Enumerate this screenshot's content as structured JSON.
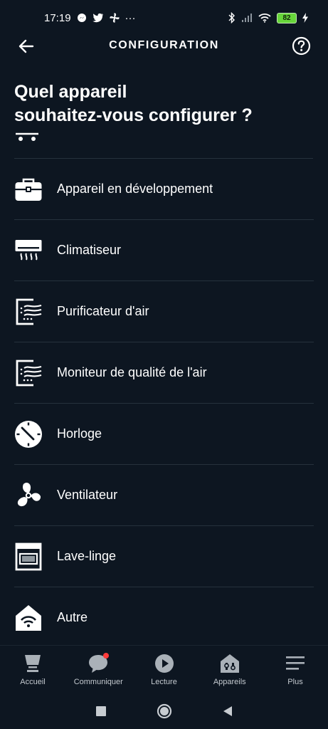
{
  "status_bar": {
    "time": "17:19",
    "more": "···",
    "battery": "82"
  },
  "header": {
    "title": "CONFIGURATION"
  },
  "page": {
    "title": "Quel appareil\nsouhaitez-vous configurer ?"
  },
  "devices": [
    {
      "label": "Appareil en développement",
      "icon": "toolbox-icon"
    },
    {
      "label": "Climatiseur",
      "icon": "air-conditioner-icon"
    },
    {
      "label": "Purificateur d'air",
      "icon": "air-purifier-icon"
    },
    {
      "label": "Moniteur de qualité de l'air",
      "icon": "air-quality-monitor-icon"
    },
    {
      "label": "Horloge",
      "icon": "clock-icon"
    },
    {
      "label": "Ventilateur",
      "icon": "fan-icon"
    },
    {
      "label": "Lave-linge",
      "icon": "washing-machine-icon"
    },
    {
      "label": "Autre",
      "icon": "smart-home-icon"
    }
  ],
  "bottom_nav": [
    {
      "label": "Accueil",
      "icon": "home-icon"
    },
    {
      "label": "Communiquer",
      "icon": "chat-icon"
    },
    {
      "label": "Lecture",
      "icon": "play-icon"
    },
    {
      "label": "Appareils",
      "icon": "devices-icon"
    },
    {
      "label": "Plus",
      "icon": "menu-icon"
    }
  ],
  "colors": {
    "background": "#0d1621",
    "divider": "#26313c",
    "battery": "#67d63a",
    "notification": "#ff3b3b"
  }
}
